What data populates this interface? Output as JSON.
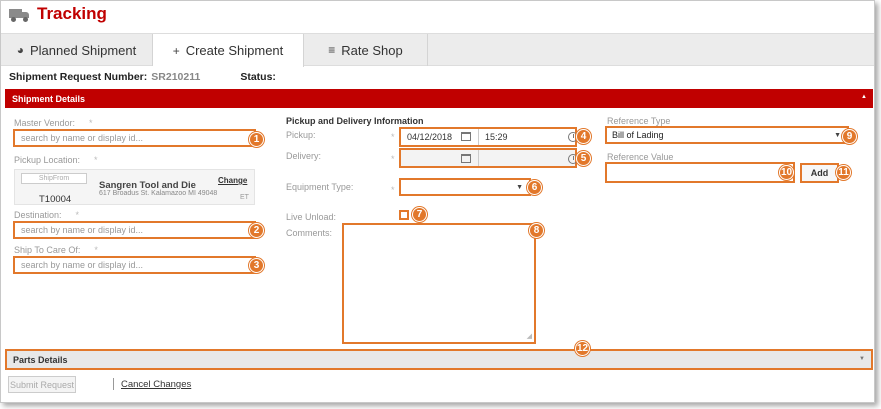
{
  "app": {
    "title": "Tracking",
    "icon": "truck-icon"
  },
  "tabs": [
    {
      "label": "Planned Shipment",
      "icon": "circle-icon",
      "glyph": "◕"
    },
    {
      "label": "Create Shipment",
      "icon": "plus-icon",
      "glyph": "+"
    },
    {
      "label": "Rate Shop",
      "icon": "list-icon",
      "glyph": "≡"
    }
  ],
  "request": {
    "label": "Shipment Request Number:",
    "number": "SR210211",
    "status_label": "Status:"
  },
  "shipment_details": {
    "title": "Shipment Details",
    "master_vendor": {
      "label": "Master Vendor:",
      "placeholder": "search by name or display id..."
    },
    "pickup_location": {
      "label": "Pickup Location:",
      "ship_from": "ShipFrom",
      "code": "T10004",
      "name": "Sangren Tool and Die",
      "address": "617 Broadus St. Kalamazoo MI 49048",
      "change": "Change",
      "timezone": "ET"
    },
    "destination": {
      "label": "Destination:",
      "placeholder": "search by name or display id..."
    },
    "ship_to_care_of": {
      "label": "Ship To Care Of:",
      "placeholder": "search by name or display id..."
    },
    "required_mark": "*"
  },
  "pickup_delivery": {
    "heading": "Pickup and Delivery Information",
    "pickup_label": "Pickup:",
    "pickup_date": "04/12/2018",
    "pickup_time": "15:29",
    "delivery_label": "Delivery:",
    "equipment_label": "Equipment Type:",
    "live_unload_label": "Live Unload:",
    "comments_label": "Comments:"
  },
  "reference": {
    "type_label": "Reference Type",
    "type_value": "Bill of Lading",
    "value_label": "Reference Value",
    "add_button": "Add"
  },
  "parts": {
    "title": "Parts Details"
  },
  "actions": {
    "submit": "Submit Request",
    "cancel": "Cancel Changes"
  },
  "callouts": [
    "1",
    "2",
    "3",
    "4",
    "5",
    "6",
    "7",
    "8",
    "9",
    "10",
    "11",
    "12"
  ],
  "colors": {
    "brand": "#c00000",
    "callout": "#e2782b"
  }
}
